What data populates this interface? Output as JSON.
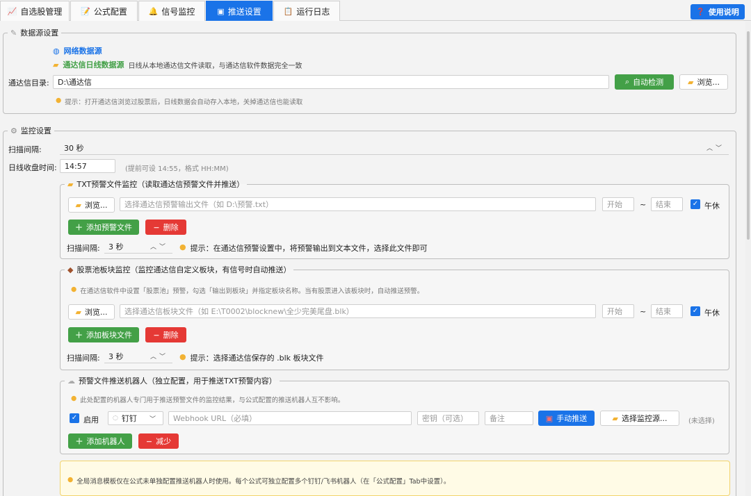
{
  "tabs": [
    {
      "icon": "📈",
      "label": "自选股管理"
    },
    {
      "icon": "📝",
      "label": "公式配置"
    },
    {
      "icon": "🔔",
      "label": "信号监控"
    },
    {
      "icon": "▣",
      "label": "推送设置"
    },
    {
      "icon": "📋",
      "label": "运行日志"
    }
  ],
  "help_button": {
    "icon": "❓",
    "label": "使用说明"
  },
  "datasource": {
    "title": "数据源设置",
    "network_option": "网络数据源",
    "tdx_option": "通达信日线数据源",
    "tdx_desc": "日线从本地通达信文件读取，与通达信软件数据完全一致",
    "dir_label": "通达信目录:",
    "dir_value": "D:\\通达信",
    "auto_detect": "自动检测",
    "browse": "浏览...",
    "tip": "提示：打开通达信浏览过股票后，日线数据会自动存入本地，关掉通达信也能读取"
  },
  "monitor": {
    "title": "监控设置",
    "scan_label": "扫描间隔:",
    "scan_value": "30 秒",
    "close_label": "日线收盘时间:",
    "close_value": "14:57",
    "close_hint": "(提前可设 14:55，格式 HH:MM)",
    "txt": {
      "title": "TXT预警文件监控（读取通达信预警文件并推送）",
      "browse": "浏览...",
      "file_placeholder": "选择通达信预警输出文件（如 D:\\预警.txt）",
      "start_placeholder": "开始",
      "tilde": "~",
      "end_placeholder": "结束",
      "noon_label": "午休",
      "add_label": "添加预警文件",
      "delete_label": "删除",
      "scan_label": "扫描间隔:",
      "scan_value": "3 秒",
      "tip": "提示：在通达信预警设置中，将预警输出到文本文件，选择此文件即可"
    },
    "pool": {
      "title": "股票池板块监控（监控通达信自定义板块，有信号时自动推送）",
      "tip_top": "在通达信软件中设置「股票池」预警，勾选「输出到板块」并指定板块名称。当有股票进入该板块时，自动推送预警。",
      "browse": "浏览...",
      "file_placeholder": "选择通达信板块文件（如 E:\\T0002\\blocknew\\全少完美尾盘.blk）",
      "start_placeholder": "开始",
      "tilde": "~",
      "end_placeholder": "结束",
      "noon_label": "午休",
      "add_label": "添加板块文件",
      "delete_label": "删除",
      "scan_label": "扫描间隔:",
      "scan_value": "3 秒",
      "tip": "提示：选择通达信保存的 .blk 板块文件"
    },
    "robot": {
      "title": "预警文件推送机器人（独立配置，用于推送TXT预警内容）",
      "tip_top": "此处配置的机器人专门用于推送预警文件的监控结果，与公式配置的推送机器人互不影响。",
      "enable_label": "启用",
      "platform_value": "钉钉",
      "webhook_placeholder": "Webhook URL（必填）",
      "secret_placeholder": "密钥（可选）",
      "remark_placeholder": "备注",
      "manual_push": "手动推送",
      "choose_source": "选择监控源...",
      "unselected": "(未选择)",
      "add_label": "添加机器人",
      "reduce_label": "减少"
    },
    "notice": "全局消息模板仅在公式未单独配置推送机器人时使用。每个公式可独立配置多个钉钉/飞书机器人（在「公式配置」Tab中设置）。"
  }
}
